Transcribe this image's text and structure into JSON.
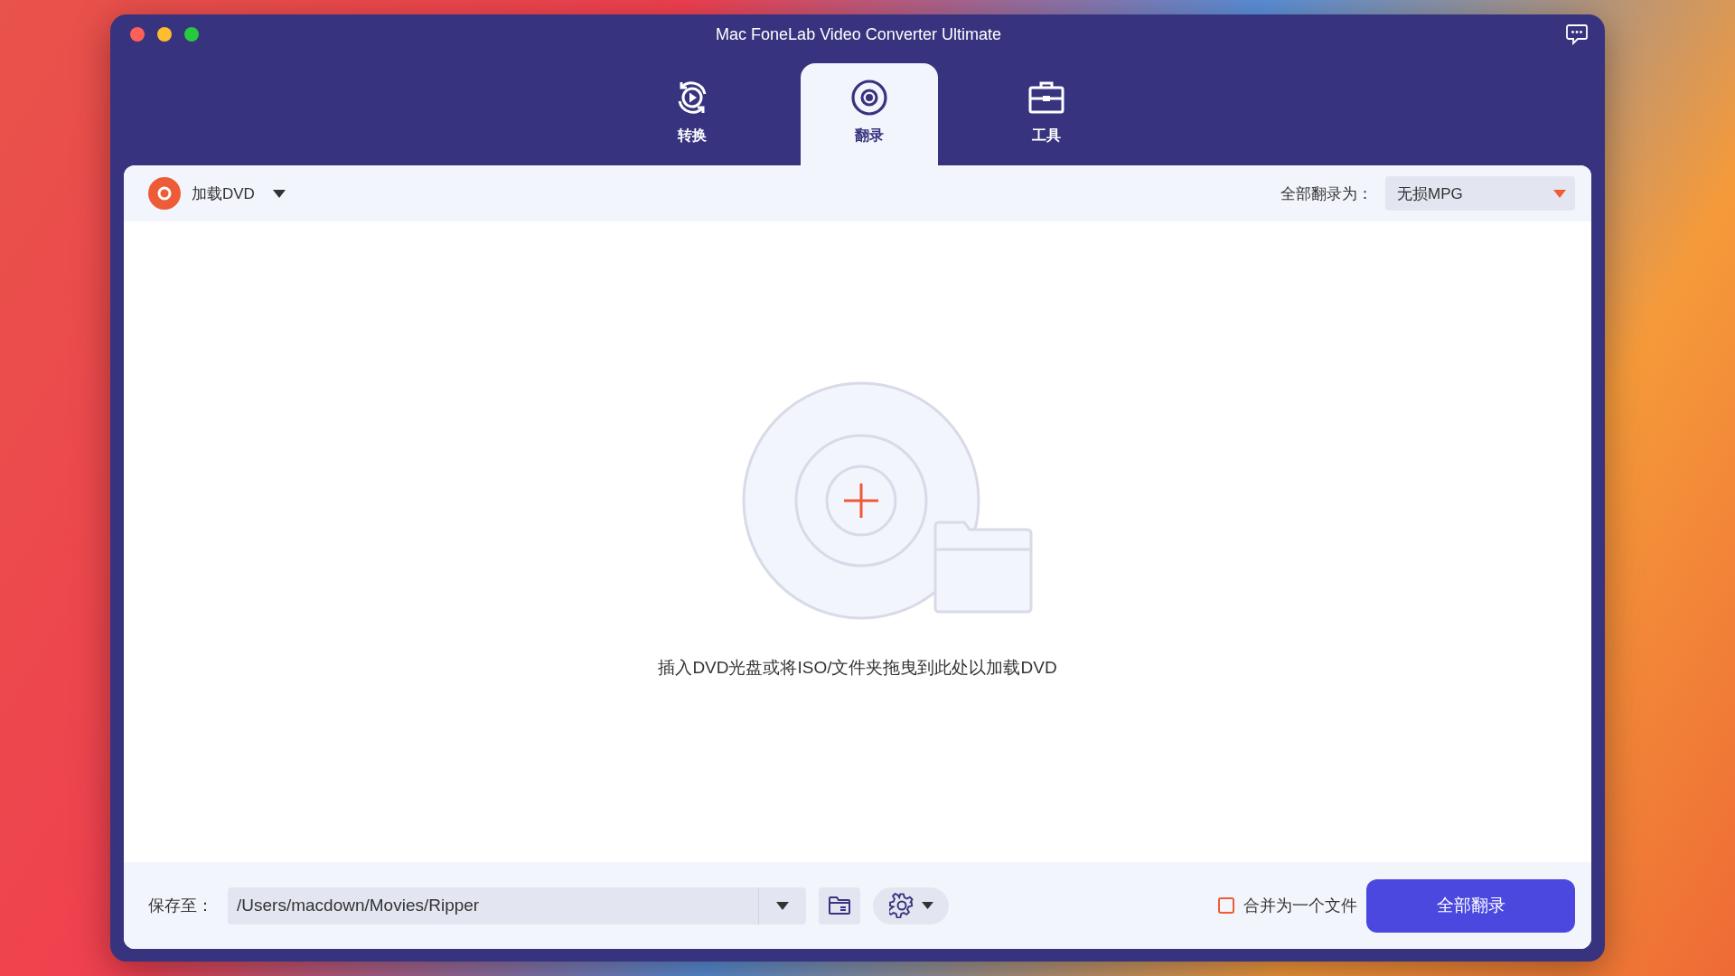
{
  "window": {
    "title": "Mac FoneLab Video Converter Ultimate"
  },
  "tabs": [
    {
      "label": "转换",
      "selected": false,
      "kind": "convert"
    },
    {
      "label": "翻录",
      "selected": true,
      "kind": "ripper"
    },
    {
      "label": "工具",
      "selected": false,
      "kind": "toolbox"
    }
  ],
  "toolbar": {
    "load_button": "加载DVD",
    "rip_all_to_label": "全部翻录为：",
    "format": "无损MPG"
  },
  "drop_area": {
    "hint": "插入DVD光盘或将ISO/文件夹拖曳到此处以加载DVD"
  },
  "bottom_bar": {
    "save_to_label": "保存至：",
    "save_path": "/Users/macdown/Movies/Ripper",
    "merge": {
      "label": "合并为一个文件",
      "checked": false
    },
    "rip_all_button": "全部翻录"
  }
}
